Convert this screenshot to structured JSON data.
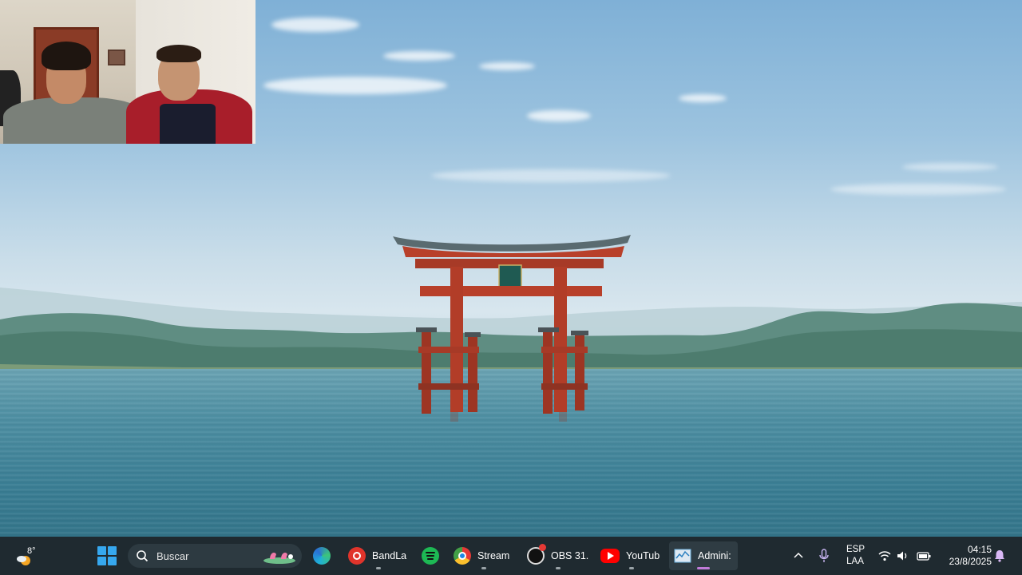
{
  "taskbar": {
    "weather": {
      "temp": "8°",
      "icon": "partly-cloudy-icon"
    },
    "start": {
      "icon": "windows-start-icon"
    },
    "search": {
      "placeholder": "Buscar",
      "icon": "search-icon"
    },
    "apps": [
      {
        "id": "edge",
        "label": "",
        "icon": "edge-icon",
        "color": "#2a8fd6",
        "running": false
      },
      {
        "id": "bandlab",
        "label": "BandLa",
        "icon": "bandlab-icon",
        "color": "#e0342b",
        "running": true
      },
      {
        "id": "spotify",
        "label": "",
        "icon": "spotify-icon",
        "color": "#1db954",
        "running": false
      },
      {
        "id": "chrome",
        "label": "Stream",
        "icon": "chrome-icon",
        "color": "#e8b82d",
        "running": true
      },
      {
        "id": "obs",
        "label": "OBS 31.",
        "icon": "obs-icon",
        "color": "#ffffff",
        "running": true
      },
      {
        "id": "youtube",
        "label": "YouTub",
        "icon": "youtube-icon",
        "color": "#ff0000",
        "running": true
      },
      {
        "id": "taskmgr",
        "label": "Admini:",
        "icon": "task-manager-icon",
        "color": "#6fb3e0",
        "running": true,
        "active": true
      }
    ],
    "tray": {
      "chevron_icon": "chevron-up-icon",
      "mic_icon": "microphone-icon",
      "language_line1": "ESP",
      "language_line2": "LAA",
      "wifi_icon": "wifi-icon",
      "volume_icon": "volume-icon",
      "battery_icon": "battery-icon",
      "time": "04:15",
      "date": "23/8/2025",
      "notification_icon": "notification-bell-icon"
    }
  },
  "colors": {
    "taskbar_bg": "#1f2a30",
    "torii_red": "#b8402a",
    "windows_blue": "#36a8ef"
  }
}
